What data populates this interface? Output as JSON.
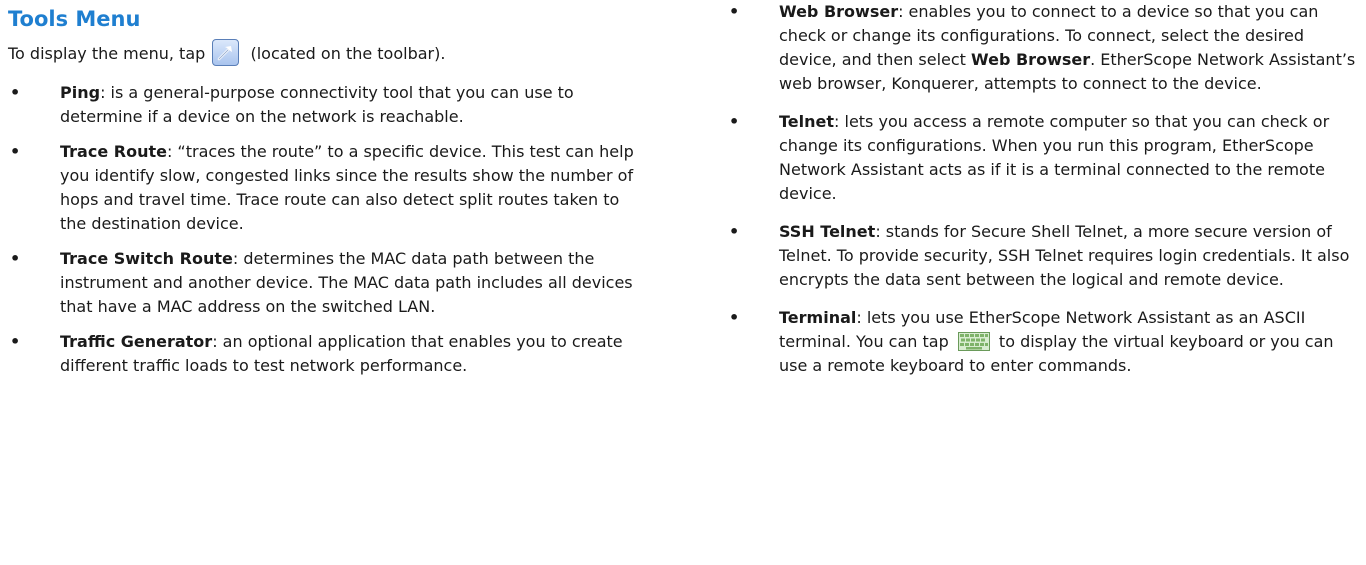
{
  "heading": "Tools Menu",
  "intro": {
    "before": "To display the menu, tap",
    "after": "(located on the toolbar)."
  },
  "icons": {
    "toolbar_tool": "tools-icon",
    "keyboard": "keyboard-icon"
  },
  "bullet_glyph": "•",
  "left_items": [
    {
      "term": "Ping",
      "text": ": is a general-purpose connectivity tool that you can use to determine if a device on the network is reachable."
    },
    {
      "term": "Trace Route",
      "text": ": “traces the route” to a specific device. This test can help you identify slow, congested links since the results show the number of hops and travel time. Trace route can also detect split routes taken to the destination device."
    },
    {
      "term": "Trace Switch Route",
      "text": ": determines the MAC data path between the instrument and another device. The MAC data path includes all devices that have a MAC address on the switched LAN."
    },
    {
      "term": "Traffic Generator",
      "text": ": an optional application that enables you to create different traffic loads to test network performance."
    }
  ],
  "right_items": {
    "web_browser": {
      "term": "Web Browser",
      "text_1": ": enables you to connect to a device so that you can check or change its configurations. To connect, select the desired device, and then select ",
      "term_inline": "Web Browser",
      "text_2": ". EtherScope Network Assistant’s web browser, Konquerer, attempts to connect to the device."
    },
    "telnet": {
      "term": "Telnet",
      "text": ": lets you access a remote computer so that you can check or change its configurations. When you run this program, EtherScope Network Assistant acts as if it is a terminal connected to the remote device."
    },
    "ssh_telnet": {
      "term": "SSH Telnet",
      "text": ": stands for Secure Shell Telnet, a more secure version of Telnet. To provide security, SSH Telnet requires login credentials. It also encrypts the data sent between the logical and remote device."
    },
    "terminal": {
      "term": "Terminal",
      "text_1": ": lets you use EtherScope Network Assistant as an ASCII terminal. You can tap",
      "text_2": "to display the virtual keyboard or you can use a remote keyboard to enter commands."
    }
  }
}
